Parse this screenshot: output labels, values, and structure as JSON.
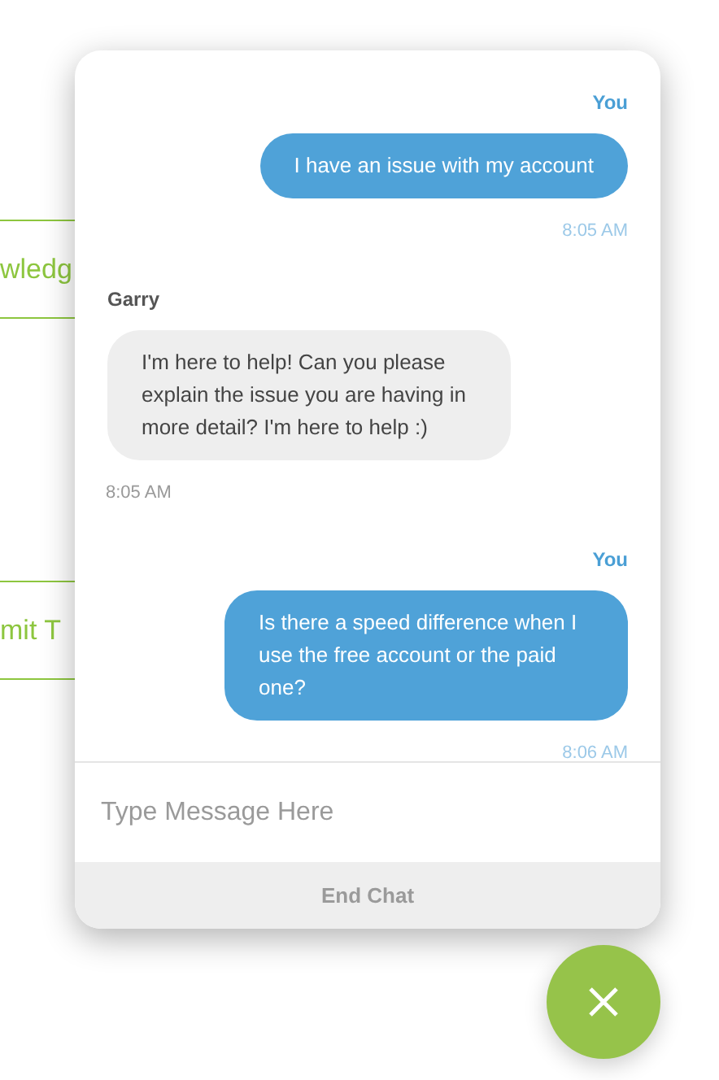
{
  "background_boxes": [
    {
      "text": "wledg"
    },
    {
      "text": "mit T"
    }
  ],
  "chat": {
    "messages": [
      {
        "kind": "outgoing",
        "sender": "You",
        "text": "I have an issue with my account",
        "time": "8:05 AM"
      },
      {
        "kind": "incoming",
        "sender": "Garry",
        "text": "I'm here to help! Can you please explain the issue you are having in more detail? I'm here to help :)",
        "time": "8:05 AM"
      },
      {
        "kind": "outgoing",
        "sender": "You",
        "text": "Is there a speed difference when I use the free account or the paid one?",
        "time": "8:06 AM"
      }
    ],
    "input": {
      "placeholder": "Type Message Here"
    },
    "end_button": "End Chat"
  }
}
